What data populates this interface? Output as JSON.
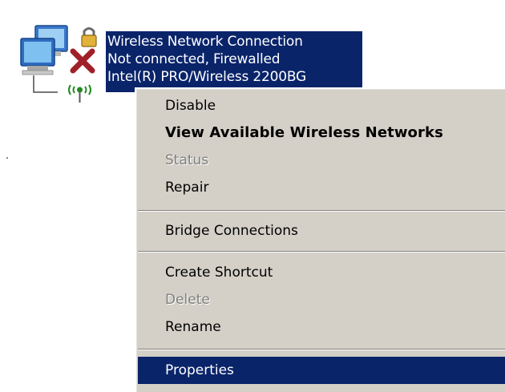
{
  "connection": {
    "name": "Wireless Network Connection",
    "status": "Not connected, Firewalled",
    "device": "Intel(R) PRO/Wireless 2200BG",
    "icon": "wireless-network-connection-icon"
  },
  "context_menu": {
    "items": [
      {
        "label": "Disable",
        "state": "enabled"
      },
      {
        "label": "View Available Wireless Networks",
        "state": "default"
      },
      {
        "label": "Status",
        "state": "disabled"
      },
      {
        "label": "Repair",
        "state": "enabled"
      },
      {
        "label": "Bridge Connections",
        "state": "enabled"
      },
      {
        "label": "Create Shortcut",
        "state": "enabled"
      },
      {
        "label": "Delete",
        "state": "disabled"
      },
      {
        "label": "Rename",
        "state": "enabled"
      },
      {
        "label": "Properties",
        "state": "highlighted"
      }
    ]
  },
  "colors": {
    "selection": "#0a246a",
    "menu_background": "#d4d0c8",
    "disabled_text": "#808080",
    "disconnected_x": "#a0202a"
  }
}
